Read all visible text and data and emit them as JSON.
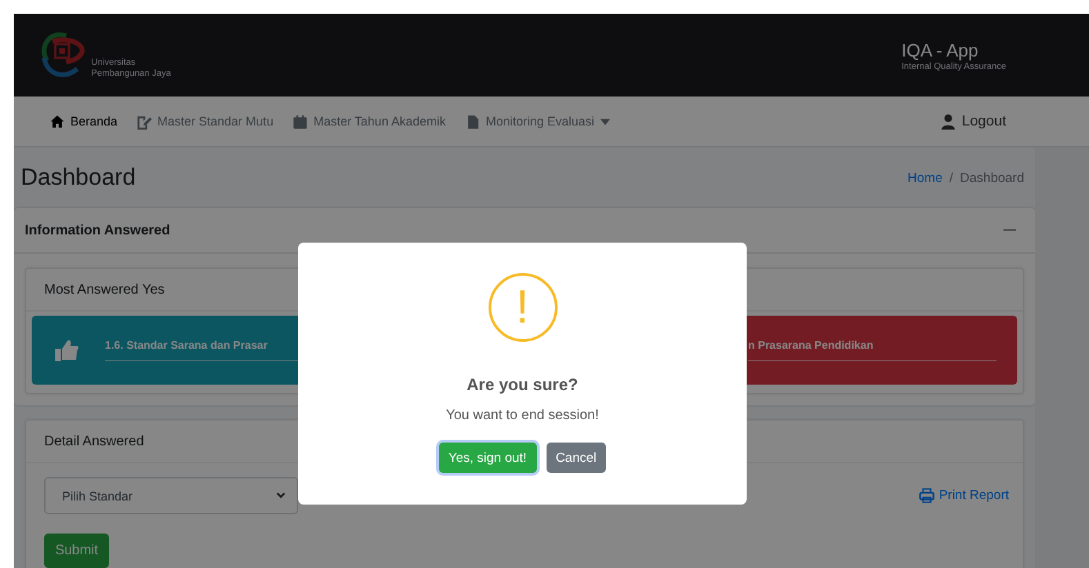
{
  "header": {
    "logo_lines": [
      "Universitas",
      "Pembangunan Jaya"
    ],
    "app_title": "IQA - App",
    "app_subtitle": "Internal Quality Assurance"
  },
  "nav": {
    "items": [
      {
        "label": "Beranda",
        "selected": true,
        "dropdown": false
      },
      {
        "label": "Master Standar Mutu",
        "selected": false,
        "dropdown": false
      },
      {
        "label": "Master Tahun Akademik",
        "selected": false,
        "dropdown": false
      },
      {
        "label": "Monitoring Evaluasi",
        "selected": false,
        "dropdown": true
      }
    ],
    "logout": "Logout"
  },
  "page": {
    "title": "Dashboard",
    "breadcrumb": [
      {
        "label": "Home",
        "kind": "link"
      },
      {
        "label": "Dashboard",
        "kind": "current"
      }
    ],
    "breadcrumb_separator": "/"
  },
  "info_card": {
    "title": "Information Answered",
    "most_yes": {
      "title": "Most Answered Yes",
      "text": "1.6. Standar Sarana dan Prasar"
    },
    "most_no": {
      "text": "n Prasarana Pendidikan"
    }
  },
  "detail_card": {
    "title": "Detail Answered",
    "select": {
      "value": "Pilih Standar"
    },
    "print": "Print Report",
    "submit": "Submit"
  },
  "dialog": {
    "icon": "!",
    "title": "Are you sure?",
    "message": "You want to end session!",
    "buttons": [
      {
        "label": "Yes, sign out!",
        "kind": "confirm"
      },
      {
        "label": "Cancel",
        "kind": "cancel"
      }
    ]
  }
}
